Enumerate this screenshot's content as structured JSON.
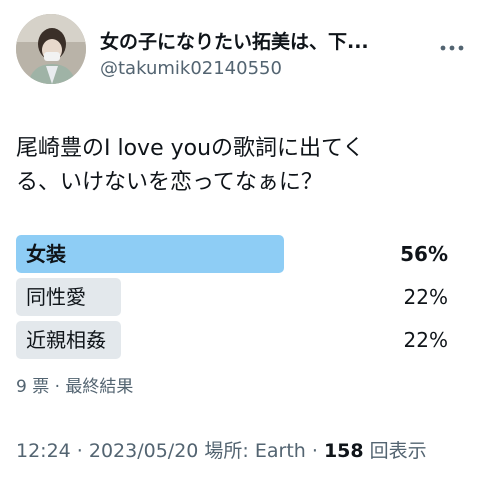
{
  "user": {
    "display_name": "女の子になりたい拓美は、下...",
    "handle": "@takumik02140550"
  },
  "tweet": {
    "text_line1": "尾崎豊のI love  youの歌詞に出てく",
    "text_line2": "る、いけないを恋ってなぁに？"
  },
  "poll": {
    "options": [
      {
        "label": "女装",
        "percent_label": "56%",
        "percent": 56,
        "winner": true
      },
      {
        "label": "同性愛",
        "percent_label": "22%",
        "percent": 22,
        "winner": false
      },
      {
        "label": "近親相姦",
        "percent_label": "22%",
        "percent": 22,
        "winner": false
      }
    ],
    "meta": "9 票 · 最終結果"
  },
  "footer": {
    "time": "12:24 · 2023/05/20",
    "location": " 場所: Earth · ",
    "view_count": "158",
    "view_label": " 回表示"
  },
  "colors": {
    "winner_bar": "#8ecdf5",
    "other_bar": "#e3e8ec",
    "secondary_text": "#536471"
  },
  "icons": {
    "more": "more-horizontal-icon"
  }
}
